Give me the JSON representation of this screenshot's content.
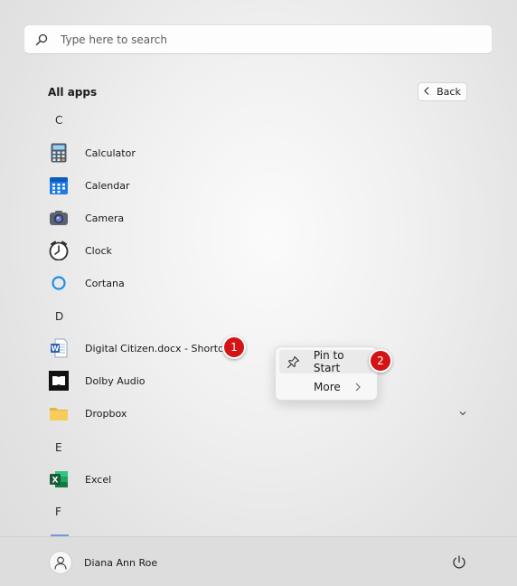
{
  "search": {
    "placeholder": "Type here to search"
  },
  "header": {
    "title": "All apps",
    "back_label": "Back"
  },
  "sections": [
    {
      "letter": "C"
    },
    {
      "letter": "D"
    },
    {
      "letter": "E"
    },
    {
      "letter": "F"
    }
  ],
  "apps": {
    "calculator": "Calculator",
    "calendar": "Calendar",
    "camera": "Camera",
    "clock": "Clock",
    "cortana": "Cortana",
    "digital_citizen": "Digital Citizen.docx - Shortcut",
    "dolby": "Dolby Audio",
    "dropbox": "Dropbox",
    "excel": "Excel"
  },
  "badges": {
    "first": "1",
    "second": "2"
  },
  "context_menu": {
    "pin_to_start": "Pin to Start",
    "more": "More"
  },
  "footer": {
    "user_name": "Diana Ann Roe"
  },
  "colors": {
    "badge_red": "#d41414",
    "accent_blue": "#0a64c8",
    "excel_green": "#1d6f42"
  },
  "icons": {
    "search": "search-icon",
    "back": "chevron-left-icon",
    "pin": "pin-icon",
    "more_chevron": "chevron-right-icon",
    "expand": "chevron-down-icon",
    "power": "power-icon",
    "user": "user-icon"
  }
}
